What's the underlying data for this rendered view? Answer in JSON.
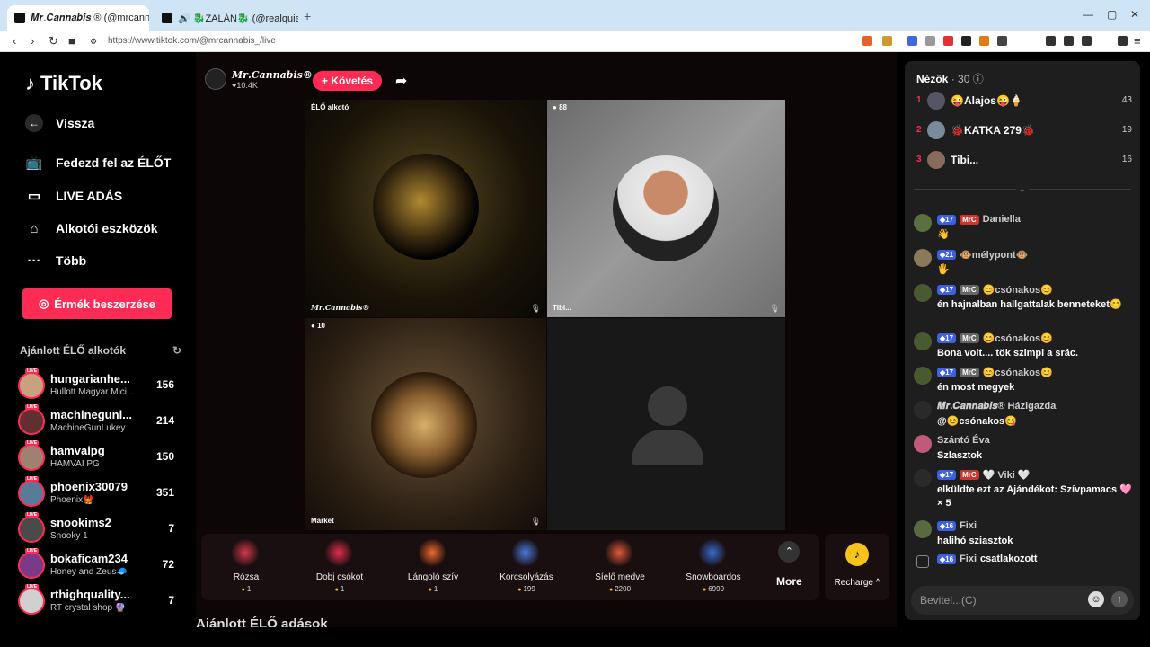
{
  "browser": {
    "tabs": [
      {
        "title": "𝑴𝒓.𝑪𝒂𝒏𝒏𝒂𝒃𝒊𝒔 ® (@mrcannab"
      },
      {
        "title": "🔊 🐉ZALÁN🐉 (@realquietalpha)"
      }
    ],
    "url": "https://www.tiktok.com/@mrcannabis_/live"
  },
  "sidebar": {
    "logo": "TikTok",
    "nav": [
      {
        "label": "Vissza"
      },
      {
        "label": "Fedezd fel az ÉLŐT"
      },
      {
        "label": "LIVE ADÁS"
      },
      {
        "label": "Alkotói eszközök"
      },
      {
        "label": "Több"
      }
    ],
    "coins_button": "Érmék beszerzése",
    "recommended_title": "Ajánlott ÉLŐ alkotók",
    "recommended": [
      {
        "name": "hungarianhe...",
        "sub": "Hullott Magyar Mici...",
        "count": "156"
      },
      {
        "name": "machinegunl...",
        "sub": "MachineGunLukey",
        "count": "214"
      },
      {
        "name": "hamvaipg",
        "sub": "HAMVAI PG",
        "count": "150"
      },
      {
        "name": "phoenix30079",
        "sub": "Phoenix🐦‍🔥",
        "count": "351"
      },
      {
        "name": "snookims2",
        "sub": "Snooky 1",
        "count": "7"
      },
      {
        "name": "bokaficam234",
        "sub": "Honey and Zeus🧢",
        "count": "72"
      },
      {
        "name": "rthighquality...",
        "sub": "RT crystal shop 🔮",
        "count": "7"
      }
    ],
    "live_badge": "LIVE"
  },
  "stage": {
    "host_name": "𝑴𝒓.𝑪𝒂𝒏𝒏𝒂𝒃𝒊𝒔®",
    "host_likes": "♥10.4K",
    "follow_label": "+ Követés",
    "tiles": [
      {
        "top_tag": "ÉLŐ alkotó",
        "name": "𝑴𝒓.𝑪𝒂𝒏𝒏𝒂𝒃𝒊𝒔®"
      },
      {
        "top_tag": "88",
        "name": "Tibi..."
      },
      {
        "top_tag": "10",
        "name": "Market"
      },
      {
        "top_tag": "",
        "name": ""
      }
    ],
    "gifts": [
      {
        "name": "Rózsa",
        "price": "1",
        "color": "#d23a4a"
      },
      {
        "name": "Dobj csókot",
        "price": "1",
        "color": "#e0304a"
      },
      {
        "name": "Lángoló szív",
        "price": "1",
        "color": "#f06a2a"
      },
      {
        "name": "Korcsolyázás",
        "price": "199",
        "color": "#4a7ae0"
      },
      {
        "name": "Síelő medve",
        "price": "2200",
        "color": "#e05a3a"
      },
      {
        "name": "Snowboardos",
        "price": "6999",
        "color": "#3a6ad0"
      }
    ],
    "more_label": "More",
    "recharge_label": "Recharge ^",
    "below_title": "Ajánlott ÉLŐ adások"
  },
  "chat": {
    "viewers_label": "Nézők",
    "viewers_count": "· 30",
    "top_viewers": [
      {
        "rank": "1",
        "name": "😜Alajos😜🍦",
        "score": "43"
      },
      {
        "rank": "2",
        "name": "🐞KATKA 279🐞",
        "score": "19"
      },
      {
        "rank": "3",
        "name": "Tibi...",
        "score": "16"
      }
    ],
    "messages": [
      {
        "lvl": "17",
        "club": "MrC",
        "user": "Daniella",
        "text": "👋"
      },
      {
        "lvl": "21",
        "club": "",
        "user": "🐵mélypont🐵",
        "text": "🖐"
      },
      {
        "lvl": "17",
        "club": "MrC",
        "user": "😊csónakos😊",
        "text": "én hajnalban hallgattalak benneteket😊"
      },
      {
        "lvl": "17",
        "club": "MrC",
        "user": "😊csónakos😊",
        "text": "Bona volt.... tök szimpi a srác."
      },
      {
        "lvl": "17",
        "club": "MrC",
        "user": "😊csónakos😊",
        "text": "én most megyek"
      },
      {
        "lvl": "",
        "club": "",
        "user": "𝑴𝒓.𝑪𝒂𝒏𝒏𝒂𝒃𝒊𝒔® Házigazda",
        "text": "@😊csónakos😋"
      },
      {
        "lvl": "",
        "club": "",
        "user": "Szántó Éva",
        "text": "Szlasztok"
      },
      {
        "lvl": "17",
        "club": "MrC",
        "user": "🤍 Viki 🤍",
        "text": "elküldte ezt az Ajándékot: Szívpamacs 🩷 × 5"
      },
      {
        "lvl": "16",
        "club": "",
        "user": "Fixi",
        "text": "halihó sziasztok"
      },
      {
        "lvl": "16",
        "club": "",
        "user": "Fixi",
        "text": "csatlakozott"
      }
    ],
    "input_placeholder": "Bevitel...(C)"
  },
  "colors": {
    "accent": "#fe2c55",
    "chat_bg": "#1e1e1e",
    "coin": "#f5c31a"
  }
}
